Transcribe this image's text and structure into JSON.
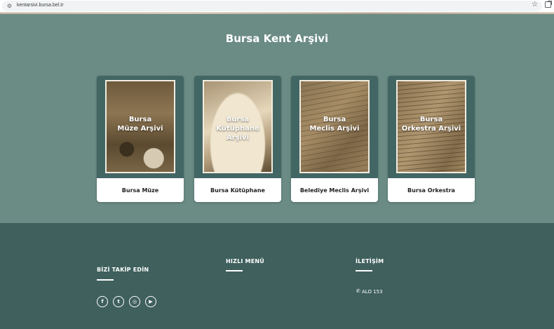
{
  "browser": {
    "url": "kentarsivi.bursa.bel.tr",
    "icons": [
      "site-info-icon",
      "bookmark-star-icon",
      "extension-icon"
    ]
  },
  "page": {
    "title": "Bursa Kent Arşivi"
  },
  "cards": [
    {
      "caption_line1": "Bursa",
      "caption_line2": "Müze Arşivi",
      "label": "Bursa Müze"
    },
    {
      "caption_line1": "Bursa",
      "caption_line2": "Kütüphane Arşivi",
      "label": "Bursa Kütüphane"
    },
    {
      "caption_line1": "Bursa",
      "caption_line2": "Meclis Arşivi",
      "label": "Belediye Meclis Arşivi"
    },
    {
      "caption_line1": "Bursa",
      "caption_line2": "Orkestra Arşivi",
      "label": "Bursa Orkestra"
    }
  ],
  "footer": {
    "follow_heading": "BİZİ TAKİP EDİN",
    "menu_heading": "HIZLI MENÜ",
    "contact_heading": "İLETİŞİM",
    "social": [
      {
        "icon": "facebook-icon",
        "glyph": "f"
      },
      {
        "icon": "twitter-icon",
        "glyph": "t"
      },
      {
        "icon": "instagram-icon",
        "glyph": "◎"
      },
      {
        "icon": "youtube-icon",
        "glyph": "▶"
      }
    ],
    "phone_icon": "phone-icon",
    "phone": "ALO 153"
  },
  "colors": {
    "main_bg": "#6b8c85",
    "card_bg": "#426663",
    "footer_bg": "#3f605d",
    "text_light": "#ffffff"
  }
}
